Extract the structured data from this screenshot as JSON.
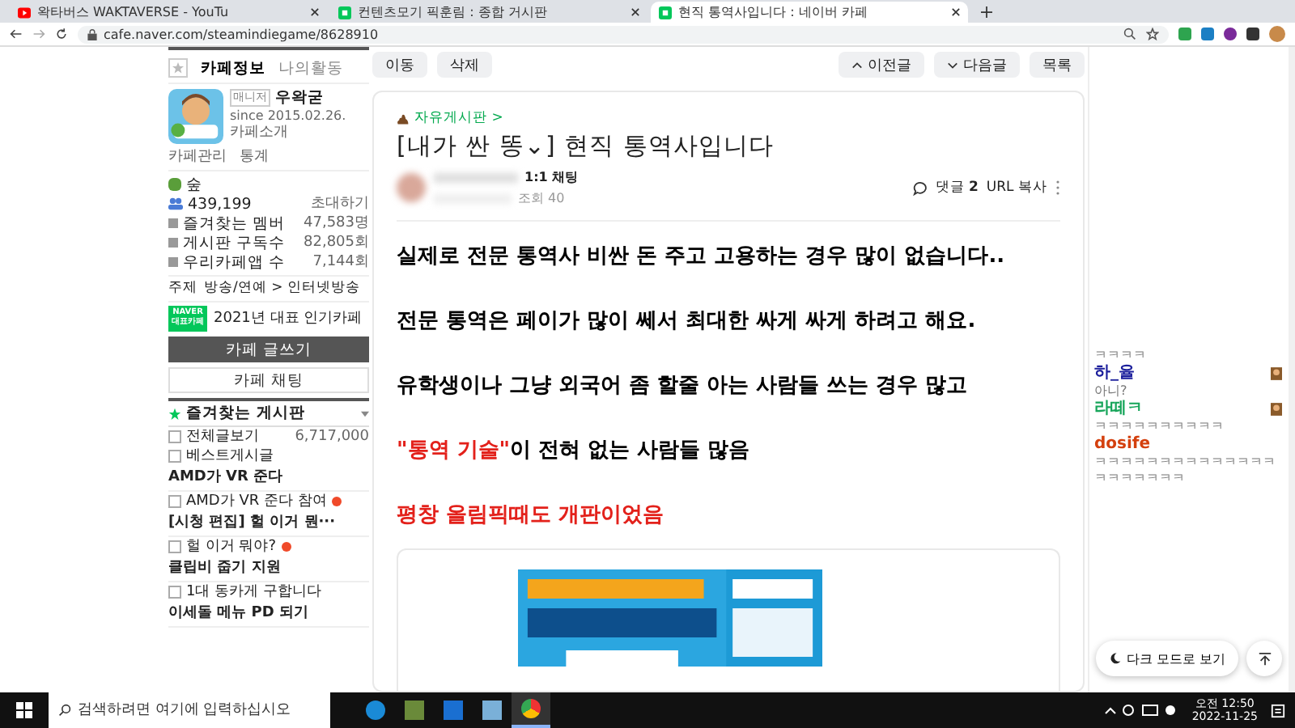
{
  "browser": {
    "tabs": [
      {
        "title": "왁타버스 WAKTAVERSE - YouTu",
        "kind": "video",
        "selected": false
      },
      {
        "title": "컨텐츠모기 픽훈림 : 종합 거시판",
        "kind": "cafe",
        "selected": false
      },
      {
        "title": "현직 통역사입니다 : 네이버 카페",
        "kind": "cafe",
        "selected": true
      }
    ],
    "address": "cafe.naver.com/steamindiegame/8628910"
  },
  "sidebar": {
    "tabs": [
      {
        "label": "카페정보",
        "selected": true
      },
      {
        "label": "나의활동",
        "selected": false
      }
    ],
    "manager_badge": "매니저",
    "manager": "우왁굳",
    "since": "since 2015.02.26.",
    "intro": "카페소개",
    "links": [
      "카페관리",
      "통계"
    ],
    "level": "숲",
    "members": "439,199",
    "invite": "초대하기",
    "stats": [
      {
        "label": "즐겨찾는 멤버",
        "value": "47,583명"
      },
      {
        "label": "게시판 구독수",
        "value": "82,805회"
      },
      {
        "label": "우리카페앱 수",
        "value": "7,144회"
      }
    ],
    "topic_label": "주제",
    "topic": "방송/연예 > 인터넷방송",
    "award_badge": [
      "NAVER",
      "대표카페"
    ],
    "award": "2021년 대표 인기카페",
    "write_button": "카페 글쓰기",
    "chat_button": "카페 채팅",
    "favorites_title": "즐겨찾는 게시판",
    "favorites": [
      {
        "kind": "board",
        "label": "전체글보기",
        "count": "6,717,000",
        "new": false
      },
      {
        "kind": "board",
        "label": "베스트게시글",
        "new": false
      },
      {
        "kind": "group",
        "label": "AMD가 VR 준다"
      },
      {
        "kind": "board",
        "label": "AMD가 VR 준다 참여",
        "new": true
      },
      {
        "kind": "group",
        "label": "[시청 편집] 헐 이거 뭔···"
      },
      {
        "kind": "board",
        "label": "헐 이거 뭐야?",
        "new": true
      },
      {
        "kind": "group",
        "label": "클립비 줍기 지원"
      },
      {
        "kind": "board",
        "label": "1대 동카게 구합니다",
        "new": false
      },
      {
        "kind": "group",
        "label": "이세돌 메뉴 PD 되기"
      }
    ]
  },
  "post": {
    "left_buttons": [
      "이동",
      "삭제"
    ],
    "prev": "이전글",
    "next": "다음글",
    "list": "목록",
    "board": "자유게시판 >",
    "title": "[내가 싼 똥⌄] 현직 통역사입니다",
    "chat": "1:1 채팅",
    "views": "조회 40",
    "comments_label": "댓글",
    "comments": "2",
    "copy_url": "URL 복사",
    "paragraphs": [
      [
        {
          "text": "실제로 전문 통역사 비싼 돈 주고 고용하는 경우 많이 없습니다..",
          "color": "#000000"
        }
      ],
      [
        {
          "text": "전문 통역은 페이가 많이 쎄서 최대한 싸게 싸게 하려고 해요.",
          "color": "#000000"
        }
      ],
      [
        {
          "text": "유학생이나 그냥 외국어 좀 할줄 아는 사람들 쓰는 경우 많고",
          "color": "#000000"
        }
      ],
      [
        {
          "text": "\"통역 기술\"",
          "color": "#e3211b"
        },
        {
          "text": "이 전혀 없는 사람들 많음",
          "color": "#000000"
        }
      ],
      [
        {
          "text": "평창 올림픽때도 개판이었음",
          "color": "#e3211b"
        }
      ]
    ]
  },
  "chat": [
    {
      "lines": [
        "ㅋㅋㅋㅋ"
      ]
    },
    {
      "user": "하_율",
      "color": "#1c1f9c",
      "avatar": true,
      "lines": [
        "아니?"
      ]
    },
    {
      "user": "라떼ㅋ",
      "color": "#17a55a",
      "avatar": true,
      "lines": [
        "ㅋㅋㅋㅋㅋㅋㅋㅋㅋㅋ"
      ]
    },
    {
      "user": "dosife",
      "color": "#d4400e",
      "avatar": false,
      "lines": [
        "ㅋㅋㅋㅋㅋㅋㅋㅋㅋㅋㅋㅋㅋㅋ",
        "ㅋㅋㅋㅋㅋㅋㅋ"
      ]
    }
  ],
  "dark_mode": "다크 모드로 보기",
  "taskbar": {
    "search": {
      "placeholder": "검색하려면 여기에 입력하십시오"
    },
    "time": "오전 12:50",
    "date": "2022-11-25"
  }
}
